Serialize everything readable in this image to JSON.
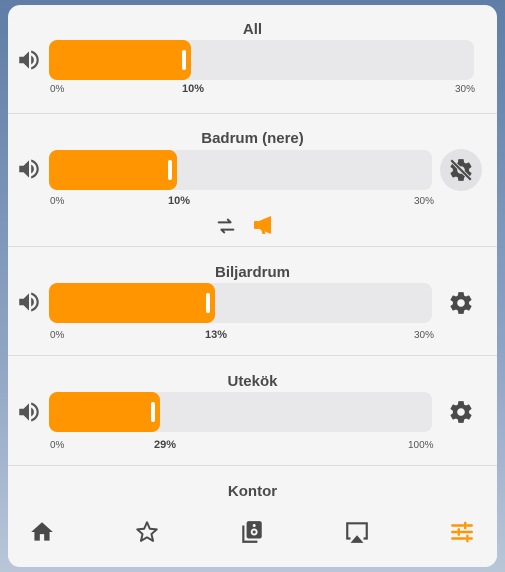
{
  "accent_color": "#ff9500",
  "rooms": [
    {
      "name": "All",
      "min_label": "0%",
      "value_label": "10%",
      "max_label": "30%",
      "fill_fraction": 0.333,
      "settings_icon": "none"
    },
    {
      "name": "Badrum (nere)",
      "min_label": "0%",
      "value_label": "10%",
      "max_label": "30%",
      "fill_fraction": 0.333,
      "settings_icon": "settings-off-icon",
      "extra_icons": [
        "swap-arrows-icon",
        "megaphone-icon"
      ]
    },
    {
      "name": "Biljardrum",
      "min_label": "0%",
      "value_label": "13%",
      "max_label": "30%",
      "fill_fraction": 0.433,
      "settings_icon": "gear-icon"
    },
    {
      "name": "Utekök",
      "min_label": "0%",
      "value_label": "29%",
      "max_label": "100%",
      "fill_fraction": 0.29,
      "settings_icon": "gear-icon"
    },
    {
      "name": "Kontor"
    }
  ],
  "tabs": [
    {
      "icon": "home-icon"
    },
    {
      "icon": "star-icon"
    },
    {
      "icon": "speaker-library-icon"
    },
    {
      "icon": "airplay-icon"
    },
    {
      "icon": "sliders-icon",
      "active": true
    }
  ]
}
